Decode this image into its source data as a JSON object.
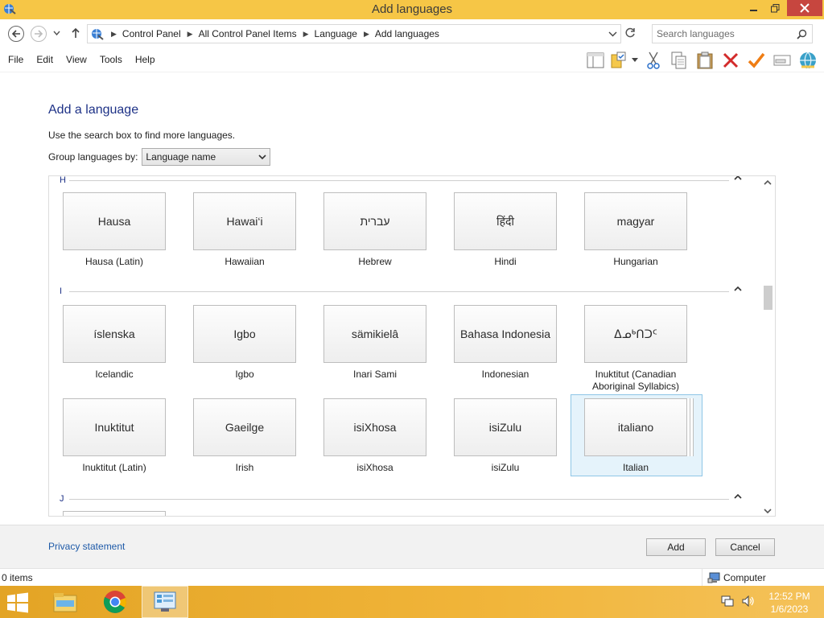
{
  "window": {
    "title": "Add languages"
  },
  "address": {
    "breadcrumb": [
      "Control Panel",
      "All Control Panel Items",
      "Language",
      "Add languages"
    ],
    "search_placeholder": "Search languages"
  },
  "menu": [
    "File",
    "Edit",
    "View",
    "Tools",
    "Help"
  ],
  "toolbar_icons": [
    "layout-pane-icon",
    "folder-options-icon",
    "dropdown-arrow-icon",
    "cut-icon",
    "copy-icon",
    "paste-icon",
    "delete-icon",
    "checkmark-icon",
    "properties-icon",
    "control-panel-globe-icon"
  ],
  "page": {
    "heading": "Add a language",
    "hint": "Use the search box to find more languages.",
    "group_label": "Group languages by:",
    "group_value": "Language name"
  },
  "groups": [
    {
      "letter": "H",
      "tiles": [
        {
          "native": "Hausa",
          "name": "Hausa (Latin)"
        },
        {
          "native": "Hawai‘i",
          "name": "Hawaiian"
        },
        {
          "native": "עברית",
          "name": "Hebrew"
        },
        {
          "native": "हिंदी",
          "name": "Hindi"
        },
        {
          "native": "magyar",
          "name": "Hungarian"
        }
      ]
    },
    {
      "letter": "I",
      "tiles": [
        {
          "native": "íslenska",
          "name": "Icelandic"
        },
        {
          "native": "Igbo",
          "name": "Igbo"
        },
        {
          "native": "sämikielâ",
          "name": "Inari Sami"
        },
        {
          "native": "Bahasa Indonesia",
          "name": "Indonesian"
        },
        {
          "native": "ᐃᓄᒃᑎᑐᑦ",
          "name": "Inuktitut (Canadian Aboriginal Syllabics)"
        },
        {
          "native": "Inuktitut",
          "name": "Inuktitut (Latin)"
        },
        {
          "native": "Gaeilge",
          "name": "Irish"
        },
        {
          "native": "isiXhosa",
          "name": "isiXhosa"
        },
        {
          "native": "isiZulu",
          "name": "isiZulu"
        },
        {
          "native": "italiano",
          "name": "Italian",
          "selected": true
        }
      ]
    },
    {
      "letter": "J",
      "tiles": []
    }
  ],
  "footer": {
    "privacy": "Privacy statement",
    "add": "Add",
    "cancel": "Cancel"
  },
  "status": {
    "items": "0 items",
    "zone": "Computer"
  },
  "taskbar": {
    "time": "12:52 PM",
    "date": "1/6/2023"
  }
}
